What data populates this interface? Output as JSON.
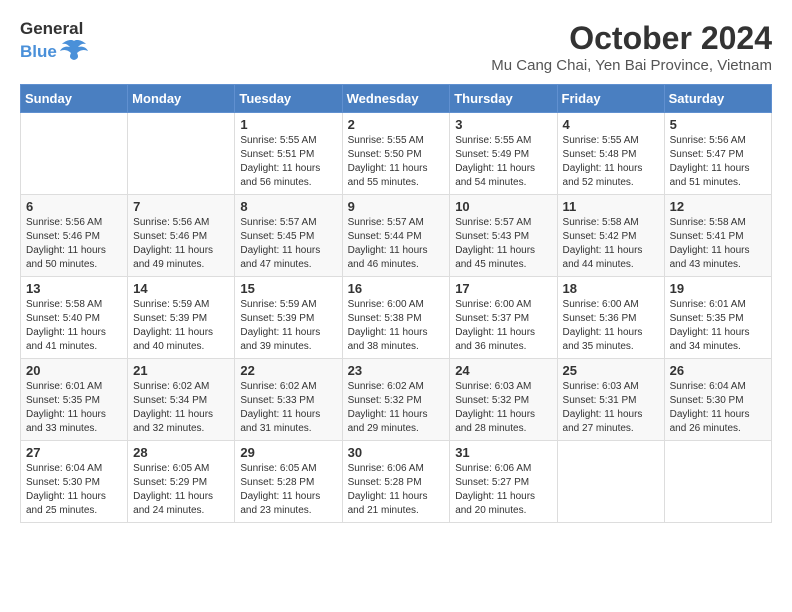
{
  "header": {
    "logo_general": "General",
    "logo_blue": "Blue",
    "month_title": "October 2024",
    "subtitle": "Mu Cang Chai, Yen Bai Province, Vietnam"
  },
  "weekdays": [
    "Sunday",
    "Monday",
    "Tuesday",
    "Wednesday",
    "Thursday",
    "Friday",
    "Saturday"
  ],
  "weeks": [
    [
      {
        "day": "",
        "info": ""
      },
      {
        "day": "",
        "info": ""
      },
      {
        "day": "1",
        "info": "Sunrise: 5:55 AM\nSunset: 5:51 PM\nDaylight: 11 hours and 56 minutes."
      },
      {
        "day": "2",
        "info": "Sunrise: 5:55 AM\nSunset: 5:50 PM\nDaylight: 11 hours and 55 minutes."
      },
      {
        "day": "3",
        "info": "Sunrise: 5:55 AM\nSunset: 5:49 PM\nDaylight: 11 hours and 54 minutes."
      },
      {
        "day": "4",
        "info": "Sunrise: 5:55 AM\nSunset: 5:48 PM\nDaylight: 11 hours and 52 minutes."
      },
      {
        "day": "5",
        "info": "Sunrise: 5:56 AM\nSunset: 5:47 PM\nDaylight: 11 hours and 51 minutes."
      }
    ],
    [
      {
        "day": "6",
        "info": "Sunrise: 5:56 AM\nSunset: 5:46 PM\nDaylight: 11 hours and 50 minutes."
      },
      {
        "day": "7",
        "info": "Sunrise: 5:56 AM\nSunset: 5:46 PM\nDaylight: 11 hours and 49 minutes."
      },
      {
        "day": "8",
        "info": "Sunrise: 5:57 AM\nSunset: 5:45 PM\nDaylight: 11 hours and 47 minutes."
      },
      {
        "day": "9",
        "info": "Sunrise: 5:57 AM\nSunset: 5:44 PM\nDaylight: 11 hours and 46 minutes."
      },
      {
        "day": "10",
        "info": "Sunrise: 5:57 AM\nSunset: 5:43 PM\nDaylight: 11 hours and 45 minutes."
      },
      {
        "day": "11",
        "info": "Sunrise: 5:58 AM\nSunset: 5:42 PM\nDaylight: 11 hours and 44 minutes."
      },
      {
        "day": "12",
        "info": "Sunrise: 5:58 AM\nSunset: 5:41 PM\nDaylight: 11 hours and 43 minutes."
      }
    ],
    [
      {
        "day": "13",
        "info": "Sunrise: 5:58 AM\nSunset: 5:40 PM\nDaylight: 11 hours and 41 minutes."
      },
      {
        "day": "14",
        "info": "Sunrise: 5:59 AM\nSunset: 5:39 PM\nDaylight: 11 hours and 40 minutes."
      },
      {
        "day": "15",
        "info": "Sunrise: 5:59 AM\nSunset: 5:39 PM\nDaylight: 11 hours and 39 minutes."
      },
      {
        "day": "16",
        "info": "Sunrise: 6:00 AM\nSunset: 5:38 PM\nDaylight: 11 hours and 38 minutes."
      },
      {
        "day": "17",
        "info": "Sunrise: 6:00 AM\nSunset: 5:37 PM\nDaylight: 11 hours and 36 minutes."
      },
      {
        "day": "18",
        "info": "Sunrise: 6:00 AM\nSunset: 5:36 PM\nDaylight: 11 hours and 35 minutes."
      },
      {
        "day": "19",
        "info": "Sunrise: 6:01 AM\nSunset: 5:35 PM\nDaylight: 11 hours and 34 minutes."
      }
    ],
    [
      {
        "day": "20",
        "info": "Sunrise: 6:01 AM\nSunset: 5:35 PM\nDaylight: 11 hours and 33 minutes."
      },
      {
        "day": "21",
        "info": "Sunrise: 6:02 AM\nSunset: 5:34 PM\nDaylight: 11 hours and 32 minutes."
      },
      {
        "day": "22",
        "info": "Sunrise: 6:02 AM\nSunset: 5:33 PM\nDaylight: 11 hours and 31 minutes."
      },
      {
        "day": "23",
        "info": "Sunrise: 6:02 AM\nSunset: 5:32 PM\nDaylight: 11 hours and 29 minutes."
      },
      {
        "day": "24",
        "info": "Sunrise: 6:03 AM\nSunset: 5:32 PM\nDaylight: 11 hours and 28 minutes."
      },
      {
        "day": "25",
        "info": "Sunrise: 6:03 AM\nSunset: 5:31 PM\nDaylight: 11 hours and 27 minutes."
      },
      {
        "day": "26",
        "info": "Sunrise: 6:04 AM\nSunset: 5:30 PM\nDaylight: 11 hours and 26 minutes."
      }
    ],
    [
      {
        "day": "27",
        "info": "Sunrise: 6:04 AM\nSunset: 5:30 PM\nDaylight: 11 hours and 25 minutes."
      },
      {
        "day": "28",
        "info": "Sunrise: 6:05 AM\nSunset: 5:29 PM\nDaylight: 11 hours and 24 minutes."
      },
      {
        "day": "29",
        "info": "Sunrise: 6:05 AM\nSunset: 5:28 PM\nDaylight: 11 hours and 23 minutes."
      },
      {
        "day": "30",
        "info": "Sunrise: 6:06 AM\nSunset: 5:28 PM\nDaylight: 11 hours and 21 minutes."
      },
      {
        "day": "31",
        "info": "Sunrise: 6:06 AM\nSunset: 5:27 PM\nDaylight: 11 hours and 20 minutes."
      },
      {
        "day": "",
        "info": ""
      },
      {
        "day": "",
        "info": ""
      }
    ]
  ]
}
